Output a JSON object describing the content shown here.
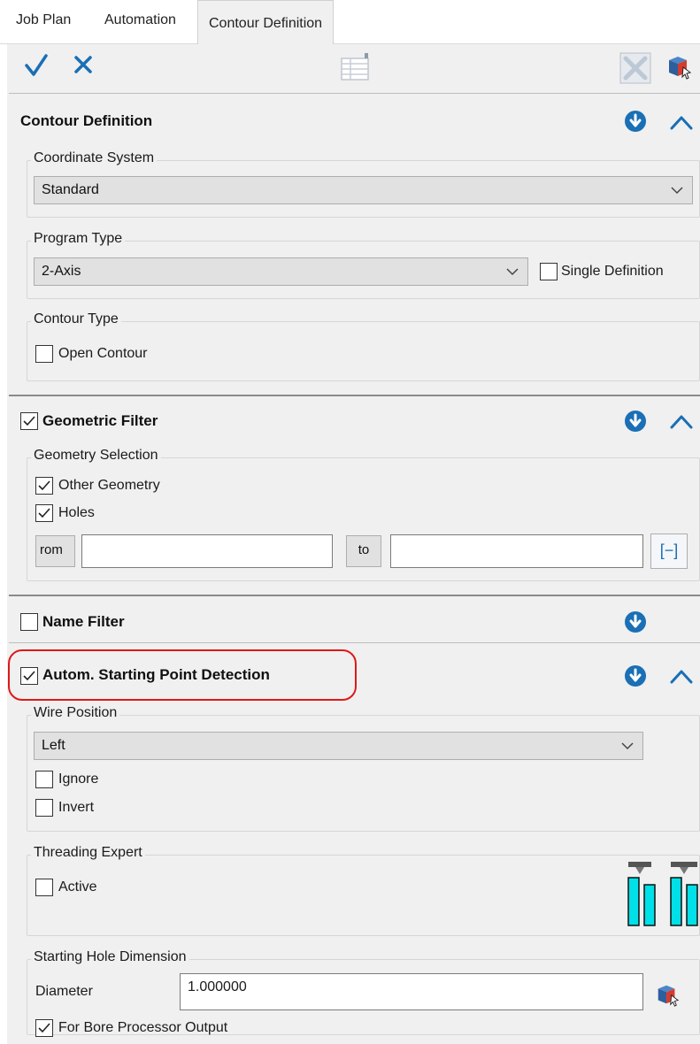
{
  "tabs": [
    {
      "label": "Job Plan"
    },
    {
      "label": "Automation"
    },
    {
      "label": "Contour Definition"
    }
  ],
  "toolbar": {
    "confirm_icon": "check-icon",
    "cancel_icon": "close-icon",
    "list_icon": "table-icon",
    "clear_icon": "clear-box-icon",
    "pick_icon": "cube-pick-icon"
  },
  "contour_definition": {
    "title": "Contour Definition",
    "coordinate_system": {
      "legend": "Coordinate System",
      "value": "Standard"
    },
    "program_type": {
      "legend": "Program Type",
      "value": "2-Axis",
      "single_definition_label": "Single Definition",
      "single_definition_checked": false
    },
    "contour_type": {
      "legend": "Contour Type",
      "open_contour_label": "Open Contour",
      "open_contour_checked": false
    }
  },
  "geometric_filter": {
    "title": "Geometric Filter",
    "checked": true,
    "geometry_selection": {
      "legend": "Geometry Selection",
      "other_geometry_label": "Other Geometry",
      "other_geometry_checked": true,
      "holes_label": "Holes",
      "holes_checked": true
    },
    "from_button": "rom",
    "from_value": "",
    "to_button": "to",
    "to_value": "",
    "range_button": "[−]"
  },
  "name_filter": {
    "title": "Name Filter",
    "checked": false
  },
  "starting_point": {
    "title": "Autom. Starting Point Detection",
    "checked": true,
    "wire_position": {
      "legend": "Wire Position",
      "value": "Left",
      "ignore_label": "Ignore",
      "ignore_checked": false,
      "invert_label": "Invert",
      "invert_checked": false
    },
    "threading_expert": {
      "legend": "Threading Expert",
      "active_label": "Active",
      "active_checked": false
    },
    "starting_hole": {
      "legend": "Starting Hole Dimension",
      "diameter_label": "Diameter",
      "diameter_value": "1.000000",
      "bore_label": "For Bore Processor Output",
      "bore_checked": true
    }
  },
  "colors": {
    "accent": "#1a6fb5",
    "highlight": "#e01818",
    "teal": "#00e0e8"
  }
}
